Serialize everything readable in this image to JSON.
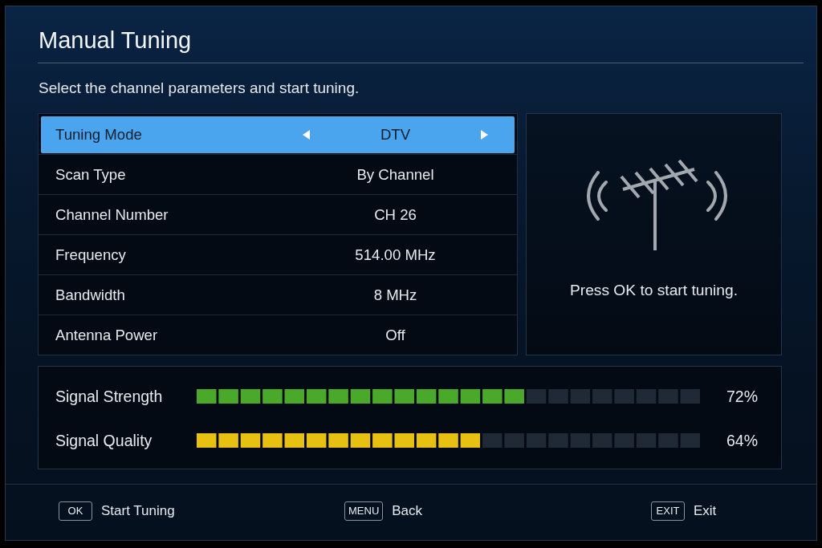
{
  "title": "Manual Tuning",
  "subtitle": "Select the channel parameters and start tuning.",
  "settings": [
    {
      "label": "Tuning Mode",
      "value": "DTV",
      "selected": true
    },
    {
      "label": "Scan Type",
      "value": "By Channel",
      "selected": false
    },
    {
      "label": "Channel Number",
      "value": "CH 26",
      "selected": false
    },
    {
      "label": "Frequency",
      "value": "514.00 MHz",
      "selected": false
    },
    {
      "label": "Bandwidth",
      "value": "8 MHz",
      "selected": false
    },
    {
      "label": "Antenna Power",
      "value": "Off",
      "selected": false
    }
  ],
  "preview": {
    "message": "Press OK to start tuning."
  },
  "signals": [
    {
      "label": "Signal Strength",
      "level": 0.65,
      "reading": "72%",
      "color": "#4aa82a"
    },
    {
      "label": "Signal Quality",
      "level": 0.57,
      "reading": "64%",
      "color": "#e8c012"
    }
  ],
  "footer": [
    {
      "key": "OK",
      "action": "Start Tuning"
    },
    {
      "key": "MENU",
      "action": "Back"
    },
    {
      "key": "EXIT",
      "action": "Exit"
    }
  ]
}
